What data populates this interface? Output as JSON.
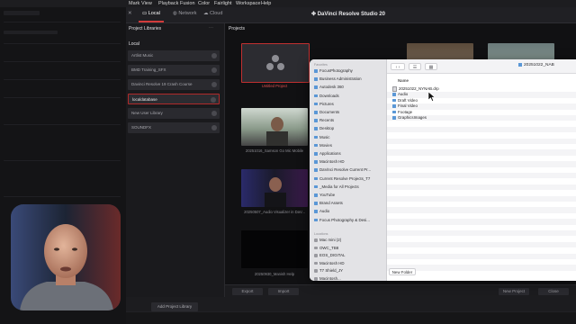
{
  "menubar": [
    "Mark",
    "View",
    "Playback",
    "Fusion",
    "Color",
    "Fairlight",
    "Workspace",
    "Help"
  ],
  "tabs": {
    "local": "Local",
    "network": "Network",
    "cloud": "Cloud"
  },
  "app_title": "DaVinci Resolve Studio 20",
  "sidebar": {
    "header": "Project Libraries",
    "section": "Local",
    "items": [
      {
        "label": "Artlist Music"
      },
      {
        "label": "BMD Training_SFX"
      },
      {
        "label": "Davinci Resolve 19 Crash Course"
      },
      {
        "label": "localdatabase"
      },
      {
        "label": "New User Library"
      },
      {
        "label": "SOUNDFX"
      }
    ],
    "add_button": "Add Project Library"
  },
  "projects": {
    "header": "Projects",
    "items": [
      {
        "caption": "Untitled Project"
      },
      {
        "caption": "20251016_Samson Go Mic Mobile"
      },
      {
        "caption": "20250507_Audio Visualizer in DaV..."
      },
      {
        "caption": "20250930_Manish Help"
      }
    ]
  },
  "bottom_buttons": {
    "export": "Export",
    "import": "Import",
    "new_project": "New Project",
    "close": "Close"
  },
  "dialog": {
    "favorites_header": "Favorites",
    "favorites": [
      "FocusPhotography",
      "Business Administration",
      "Autodesk 360",
      "Downloads",
      "Pictures",
      "Documents",
      "Recents",
      "Desktop",
      "Music",
      "Movies",
      "Applications",
      "Macintosh HD",
      "DaVinci Resolve Current Pr...",
      "Current Resolve Projects_T7",
      "_Media for All Projects",
      "YouTube",
      "Brand Assets",
      "Audio",
      "Focus Photography & Desi..."
    ],
    "locations_header": "Locations",
    "locations": [
      "Mac mini (2)",
      "OWC_TB8",
      "EOS_DIGITAL",
      "Macintosh HD",
      "T7 Shield_JY",
      "Macintosh..."
    ],
    "path": "20251022_NAB",
    "column_header": "Name",
    "files": [
      {
        "name": "20251022_NYNAB.drp",
        "kind": "doc"
      },
      {
        "name": "Audio",
        "kind": "folder"
      },
      {
        "name": "Draft Video",
        "kind": "folder"
      },
      {
        "name": "Final Video",
        "kind": "folder"
      },
      {
        "name": "Footage",
        "kind": "folder"
      },
      {
        "name": "GraphicsImages",
        "kind": "folder"
      }
    ],
    "new_folder": "New Folder"
  }
}
